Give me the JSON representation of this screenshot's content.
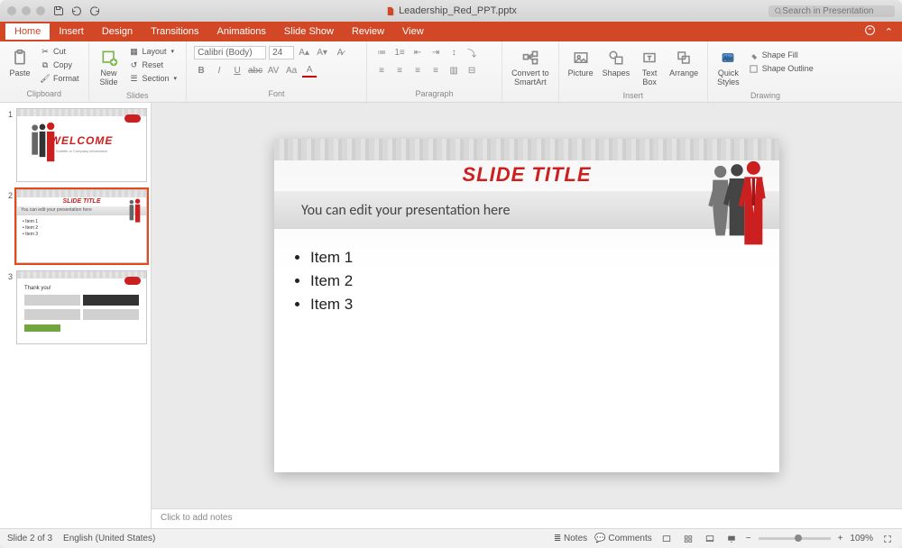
{
  "filename": "Leadership_Red_PPT.pptx",
  "search_placeholder": "Search in Presentation",
  "tabs": [
    "Home",
    "Insert",
    "Design",
    "Transitions",
    "Animations",
    "Slide Show",
    "Review",
    "View"
  ],
  "active_tab": 0,
  "ribbon": {
    "clipboard": {
      "paste": "Paste",
      "cut": "Cut",
      "copy": "Copy",
      "format": "Format",
      "label": "Clipboard"
    },
    "slides": {
      "new": "New\nSlide",
      "layout": "Layout",
      "reset": "Reset",
      "section": "Section",
      "label": "Slides"
    },
    "font": {
      "name": "Calibri (Body)",
      "size": "24",
      "label": "Font"
    },
    "paragraph": {
      "label": "Paragraph"
    },
    "smartart": {
      "btn": "Convert to\nSmartArt"
    },
    "insert": {
      "picture": "Picture",
      "shapes": "Shapes",
      "textbox": "Text\nBox",
      "arrange": "Arrange",
      "label": "Insert"
    },
    "format": {
      "quick": "Quick\nStyles",
      "fill": "Shape Fill",
      "outline": "Shape Outline",
      "label": "Drawing"
    }
  },
  "thumbs": [
    {
      "n": 1,
      "title": "WELCOME",
      "subtitle": "Subtitle or Company information"
    },
    {
      "n": 2,
      "title": "SLIDE TITLE",
      "subtitle": "You can edit your presentation here",
      "items": [
        "Item 1",
        "Item 2",
        "Item 3"
      ]
    },
    {
      "n": 3,
      "thank": "Thank you!"
    }
  ],
  "selected_thumb": 1,
  "slide": {
    "title": "SLIDE TITLE",
    "subtitle": "You can edit your presentation here",
    "bullets": [
      "Item 1",
      "Item 2",
      "Item 3"
    ]
  },
  "notes_placeholder": "Click to add notes",
  "status": {
    "slide": "Slide 2 of 3",
    "lang": "English (United States)",
    "notes": "Notes",
    "comments": "Comments",
    "zoom": "109%"
  }
}
